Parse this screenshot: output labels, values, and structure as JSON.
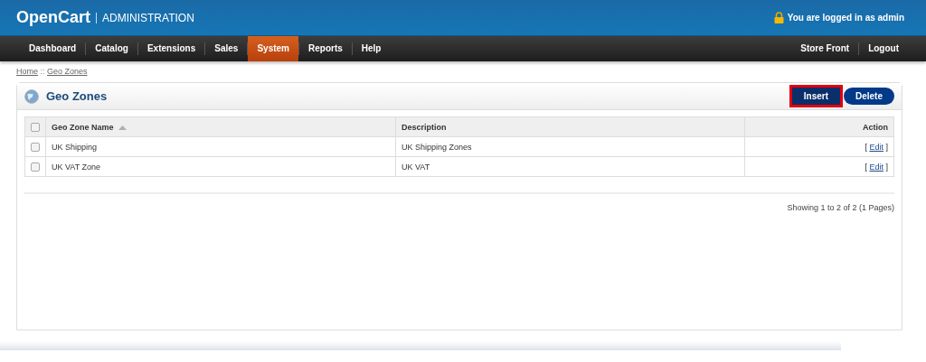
{
  "header": {
    "logo": "OpenCart",
    "subtitle": "ADMINISTRATION",
    "login_text": "You are logged in as admin"
  },
  "menu": [
    {
      "label": "Dashboard",
      "selected": false
    },
    {
      "label": "Catalog",
      "selected": false
    },
    {
      "label": "Extensions",
      "selected": false
    },
    {
      "label": "Sales",
      "selected": false
    },
    {
      "label": "System",
      "selected": true
    },
    {
      "label": "Reports",
      "selected": false
    },
    {
      "label": "Help",
      "selected": false
    }
  ],
  "menu_right": [
    "Store Front",
    "Logout"
  ],
  "breadcrumb": [
    {
      "label": "Home"
    },
    {
      "label": "Geo Zones"
    }
  ],
  "breadcrumb_separator": " :: ",
  "panel": {
    "title": "Geo Zones",
    "buttons": [
      {
        "label": "Insert",
        "highlighted": true
      },
      {
        "label": "Delete",
        "highlighted": false
      }
    ]
  },
  "table": {
    "columns": [
      "Geo Zone Name",
      "Description",
      "Action"
    ],
    "header_checked": false,
    "rows": [
      {
        "name": "UK Shipping",
        "description": "UK Shipping Zones",
        "checked": false,
        "action_open": "[",
        "action": "Edit",
        "action_close": "]"
      },
      {
        "name": "UK VAT Zone",
        "description": "UK VAT",
        "checked": false,
        "action_open": "[",
        "action": "Edit",
        "action_close": "]"
      }
    ]
  },
  "pagination": "Showing 1 to 2 of 2 (1 Pages)"
}
